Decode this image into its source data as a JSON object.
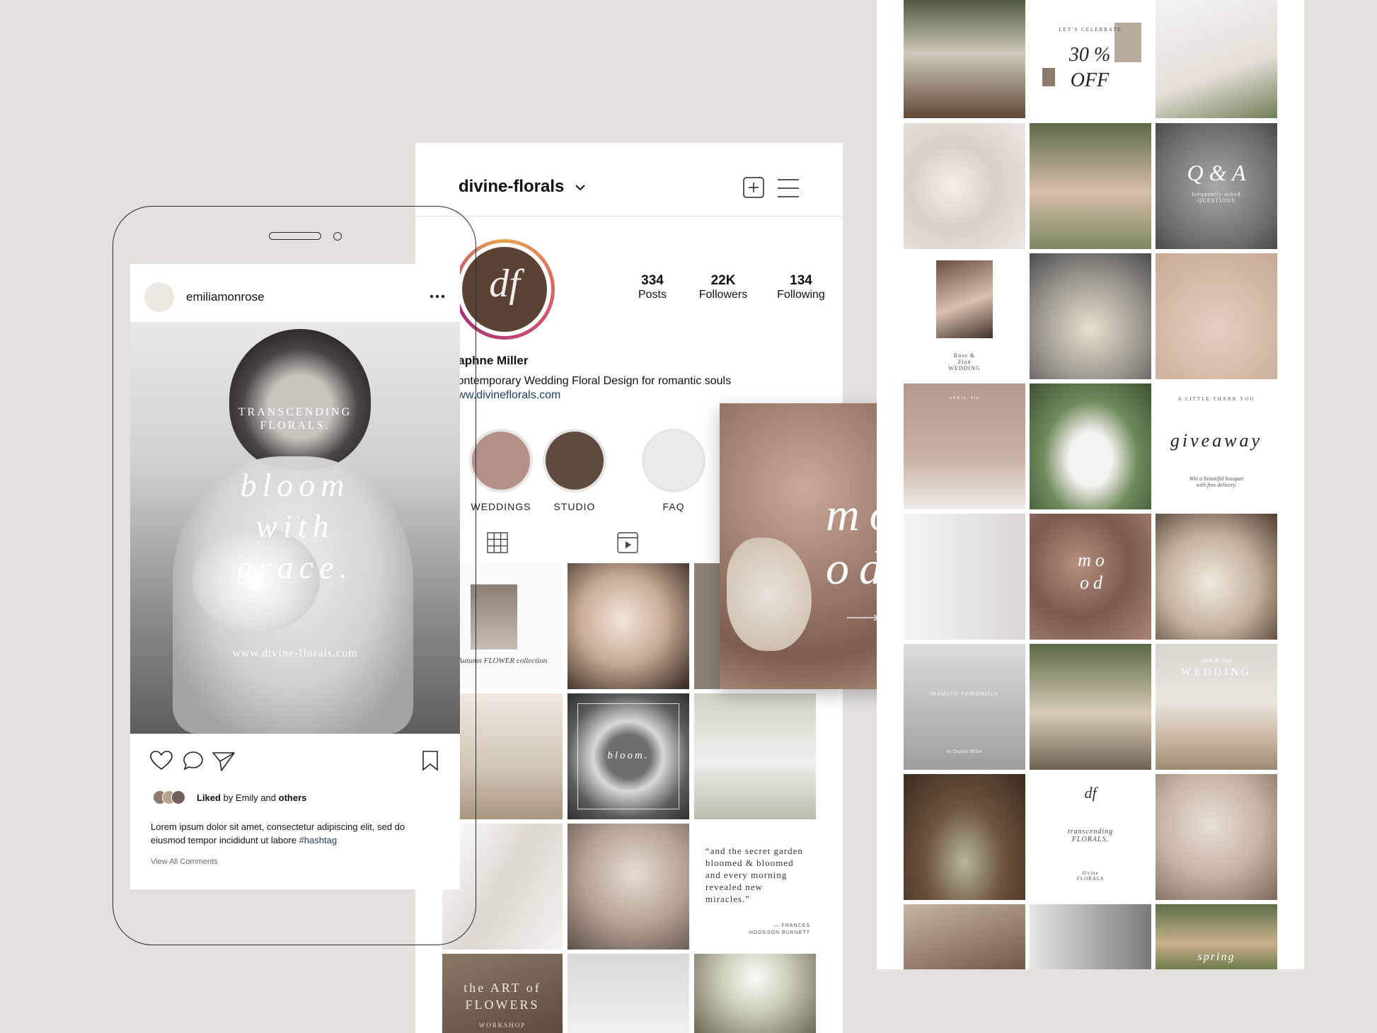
{
  "profile": {
    "username": "divine-florals",
    "logo_initials": "df",
    "name": "Daphne Miller",
    "bio": "Contemporary Wedding Floral Design for romantic souls",
    "website": "www.divineflorals.com",
    "stats": [
      {
        "value": "334",
        "label": "Posts"
      },
      {
        "value": "22K",
        "label": "Followers"
      },
      {
        "value": "134",
        "label": "Following"
      }
    ],
    "highlights": [
      {
        "label": "WEDDINGS",
        "color": "#b39189"
      },
      {
        "label": "STUDIO",
        "color": "#5e4a3e"
      },
      {
        "label": "FAQ",
        "color": "#ecebe6"
      }
    ]
  },
  "post": {
    "username": "emiliamonrose",
    "image_headline": "TRANSCENDING FLORALS.",
    "image_script": [
      "bloom",
      "with",
      "grace."
    ],
    "image_url": "www.divine-florals.com",
    "liked_prefix": "Liked",
    "liked_by": "by Emily and",
    "liked_others": "others",
    "caption": "Lorem ipsum dolor sit amet, consectetur adipiscing elit, sed do eiusmod tempor incididunt ut labore",
    "hashtag": "#hashtag",
    "view_comments": "View All Comments"
  },
  "grid_texts": {
    "autumn_collection": "Autumn FLOWER collection",
    "bloom": "bloom.",
    "quote": "“and the secret garden bloomed & bloomed and every morning revealed new miracles.”",
    "quote_author": "— FRANCES HODGSON BURNETT",
    "art_of_flowers": "the ART of FLOWERS",
    "workshop": "WORKSHOP",
    "mood_big": "mo od",
    "mood_small": "mo od",
    "lets_celebrate": "LET'S CELEBRATE",
    "sale": "30 % OFF",
    "qa": "Q & A",
    "faq_sub": "frequently asked QUESTIONS",
    "rose_zion": "Rose & Zion WEDDING",
    "date": "APRIL 4th",
    "thank_you": "A LITTLE THANK YOU",
    "giveaway": "giveaway",
    "giveaway_sub": "Win a beautiful bouquet with free delivery.",
    "modern_romantics": "modern romantics",
    "by_daphne": "by Daphne Miller",
    "dane_rose": "dane & rose",
    "wedding": "WEDDING",
    "transcending": "transcending FLORALS.",
    "divine_florals": "divine FLORALS",
    "spring": "spring"
  }
}
